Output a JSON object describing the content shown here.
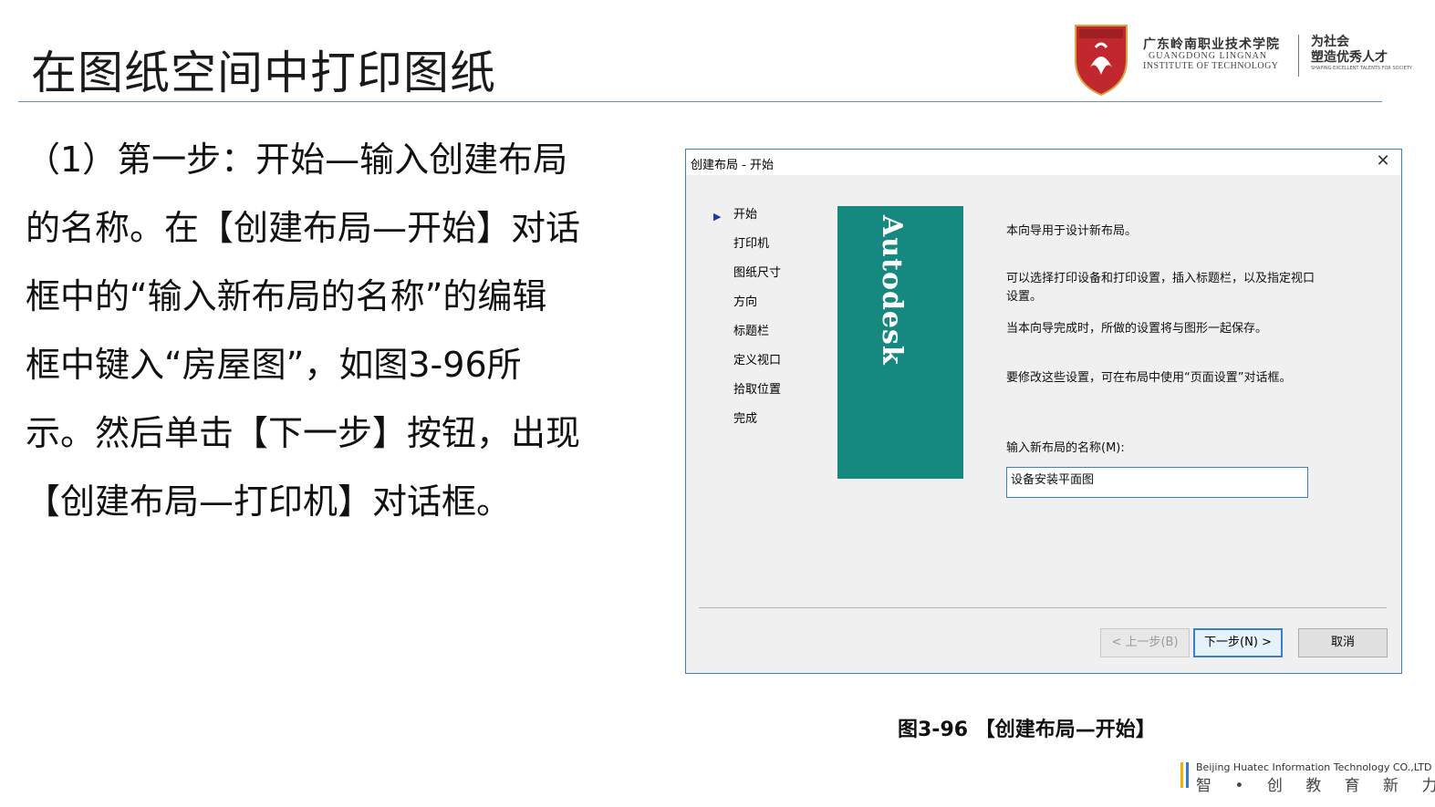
{
  "slide": {
    "title": "在图纸空间中打印图纸",
    "paragraph_lines": [
      "（1）第一步：开始—输入创建布局",
      "的名称。在【创建布局—开始】对话",
      "框中的“输入新布局的名称”的编辑",
      "框中键入“房屋图”，如图3-96所",
      "示。然后单击【下一步】按钮，出现",
      "【创建布局—打印机】对话框。"
    ],
    "caption": "图3-96  【创建布局—开始】"
  },
  "logo": {
    "name_cn": "广东岭南职业技术学院",
    "name_en_line1": "GUANGDONG LINGNAN",
    "name_en_line2": "INSTITUTE OF TECHNOLOGY",
    "motto_line1": "为社会",
    "motto_line2": "塑造优秀人才",
    "motto_en": "SHAPING EXCELLENT TALENTS FOR SOCIETY",
    "shield_color": "#c0282d"
  },
  "dialog": {
    "title": "创建布局 - 开始",
    "close_icon": "close-icon",
    "steps": [
      "开始",
      "打印机",
      "图纸尺寸",
      "方向",
      "标题栏",
      "定义视口",
      "拾取位置",
      "完成"
    ],
    "current_step": "开始",
    "brand": "Autodesk",
    "brand_color": "#15897f",
    "info": [
      "本向导用于设计新布局。",
      "可以选择打印设备和打印设置，插入标题栏，以及指定视口设置。",
      "当本向导完成时，所做的设置将与图形一起保存。",
      "要修改这些设置，可在布局中使用“页面设置”对话框。"
    ],
    "name_label": "输入新布局的名称(M):",
    "name_value": "设备安装平面图",
    "buttons": {
      "back": "< 上一步(B)",
      "next": "下一步(N) >",
      "cancel": "取消"
    },
    "accent_color": "#3c7fc5"
  },
  "footer": {
    "company_en": "Beijing Huatec Information Technology CO.,LTD",
    "slogan_cn": "智 • 创 教 育 新 力 量"
  }
}
